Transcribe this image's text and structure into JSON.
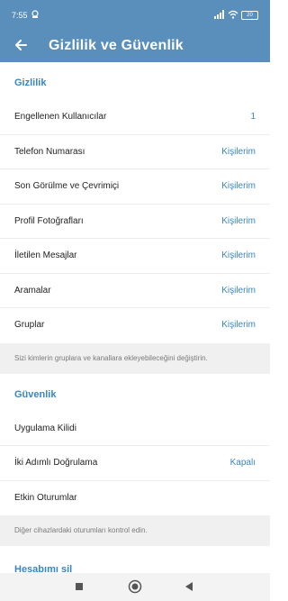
{
  "status_bar": {
    "time": "7:55",
    "battery": "20"
  },
  "app_bar": {
    "title": "Gizlilik ve Güvenlik"
  },
  "privacy": {
    "header": "Gizlilik",
    "items": [
      {
        "label": "Engellenen Kullanıcılar",
        "value": "1"
      },
      {
        "label": "Telefon Numarası",
        "value": "Kişilerim"
      },
      {
        "label": "Son Görülme ve Çevrimiçi",
        "value": "Kişilerim"
      },
      {
        "label": "Profil Fotoğrafları",
        "value": "Kişilerim"
      },
      {
        "label": "İletilen Mesajlar",
        "value": "Kişilerim"
      },
      {
        "label": "Aramalar",
        "value": "Kişilerim"
      },
      {
        "label": "Gruplar",
        "value": "Kişilerim"
      }
    ],
    "footer": "Sizi kimlerin gruplara ve kanallara ekleyebileceğini değiştirin."
  },
  "security": {
    "header": "Güvenlik",
    "items": [
      {
        "label": "Uygulama Kilidi",
        "value": ""
      },
      {
        "label": "İki Adımlı Doğrulama",
        "value": "Kapalı"
      },
      {
        "label": "Etkin Oturumlar",
        "value": ""
      }
    ],
    "footer": "Diğer cihazlardaki oturumları kontrol edin."
  },
  "delete_account": {
    "header": "Hesabımı sil"
  },
  "colors": {
    "accent": "#3a86c1",
    "bar": "#5a8fbb"
  }
}
